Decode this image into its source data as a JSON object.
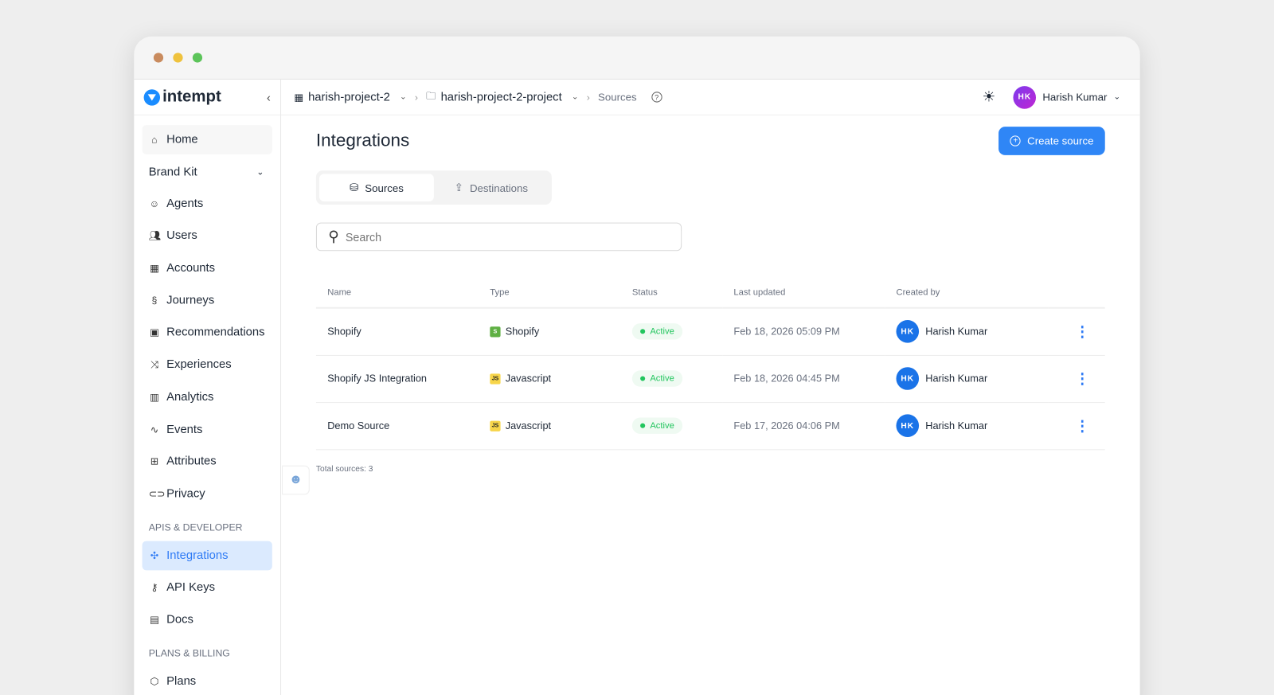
{
  "sidebar": {
    "brand": "intempt",
    "items": [
      {
        "label": "Home",
        "icon": "home-icon"
      },
      {
        "label": "Agents",
        "icon": "robot-icon"
      },
      {
        "label": "Users",
        "icon": "users-icon"
      },
      {
        "label": "Accounts",
        "icon": "building-icon"
      },
      {
        "label": "Journeys",
        "icon": "journey-icon"
      },
      {
        "label": "Recommendations",
        "icon": "bag-icon"
      },
      {
        "label": "Experiences",
        "icon": "shuffle-icon"
      },
      {
        "label": "Analytics",
        "icon": "chart-icon"
      },
      {
        "label": "Events",
        "icon": "pulse-icon"
      },
      {
        "label": "Attributes",
        "icon": "table-icon"
      },
      {
        "label": "Privacy",
        "icon": "mask-icon"
      },
      {
        "label": "Integrations",
        "icon": "puzzle-icon"
      },
      {
        "label": "API Keys",
        "icon": "key-icon"
      },
      {
        "label": "Docs",
        "icon": "doc-icon"
      },
      {
        "label": "Plans",
        "icon": "box-icon"
      }
    ],
    "brand_kit": "Brand Kit",
    "section_api": "APIS & DEVELOPER",
    "section_billing": "PLANS & BILLING"
  },
  "header": {
    "org": "harish-project-2",
    "project": "harish-project-2-project",
    "page": "Sources",
    "user": "Harish Kumar",
    "initials": "HK"
  },
  "main": {
    "title": "Integrations",
    "create_label": "Create source",
    "tabs": [
      {
        "label": "Sources"
      },
      {
        "label": "Destinations"
      }
    ],
    "search_placeholder": "Search",
    "columns": [
      "Name",
      "Type",
      "Status",
      "Last updated",
      "Created by"
    ],
    "rows": [
      {
        "name": "Shopify",
        "type": "Shopify",
        "type_badge": "S",
        "status": "Active",
        "updated": "Feb 18, 2026 05:09 PM",
        "creator": "Harish Kumar",
        "initials": "HK"
      },
      {
        "name": "Shopify JS Integration",
        "type": "Javascript",
        "type_badge": "JS",
        "status": "Active",
        "updated": "Feb 18, 2026 04:45 PM",
        "creator": "Harish Kumar",
        "initials": "HK"
      },
      {
        "name": "Demo Source",
        "type": "Javascript",
        "type_badge": "JS",
        "status": "Active",
        "updated": "Feb 17, 2026 04:06 PM",
        "creator": "Harish Kumar",
        "initials": "HK"
      }
    ],
    "total": "Total sources: 3"
  },
  "colors": {
    "accent": "#2f86f6",
    "active": "#22c55e"
  }
}
